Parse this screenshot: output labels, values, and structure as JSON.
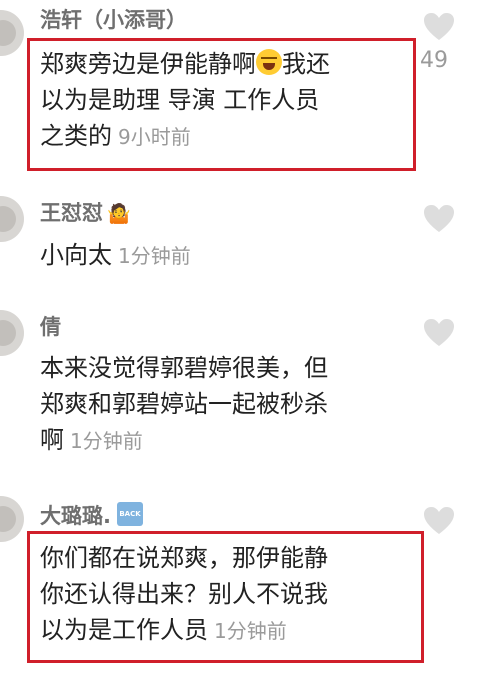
{
  "comments": [
    {
      "username": "浩轩（小添哥）",
      "lines": [
        "郑爽旁边是伊能静啊",
        "以为是助理 导演 工作人员",
        "之类的"
      ],
      "line1_after_emoji": "我还",
      "timestamp": "9小时前",
      "likes": "49",
      "emoji_icon": "rofl-emoji-icon"
    },
    {
      "username": "王怼怼",
      "name_emoji": "🤷",
      "lines": [
        "小向太"
      ],
      "timestamp": "1分钟前"
    },
    {
      "username": "倩",
      "lines": [
        "本来没觉得郭碧婷很美，但",
        "郑爽和郭碧婷站一起被秒杀",
        "啊"
      ],
      "timestamp": "1分钟前"
    },
    {
      "username": "大璐璐.",
      "name_badge": "BACK",
      "lines": [
        "你们都在说郑爽，那伊能静",
        "你还认得出来？别人不说我",
        "以为是工作人员"
      ],
      "timestamp": "1分钟前"
    }
  ],
  "colors": {
    "highlight": "#d01f2a",
    "username": "#6f6f6f",
    "body_text": "#222222",
    "meta_text": "#9a9a9a",
    "heart": "#dddddd"
  },
  "icons": {
    "like": "heart-icon"
  }
}
